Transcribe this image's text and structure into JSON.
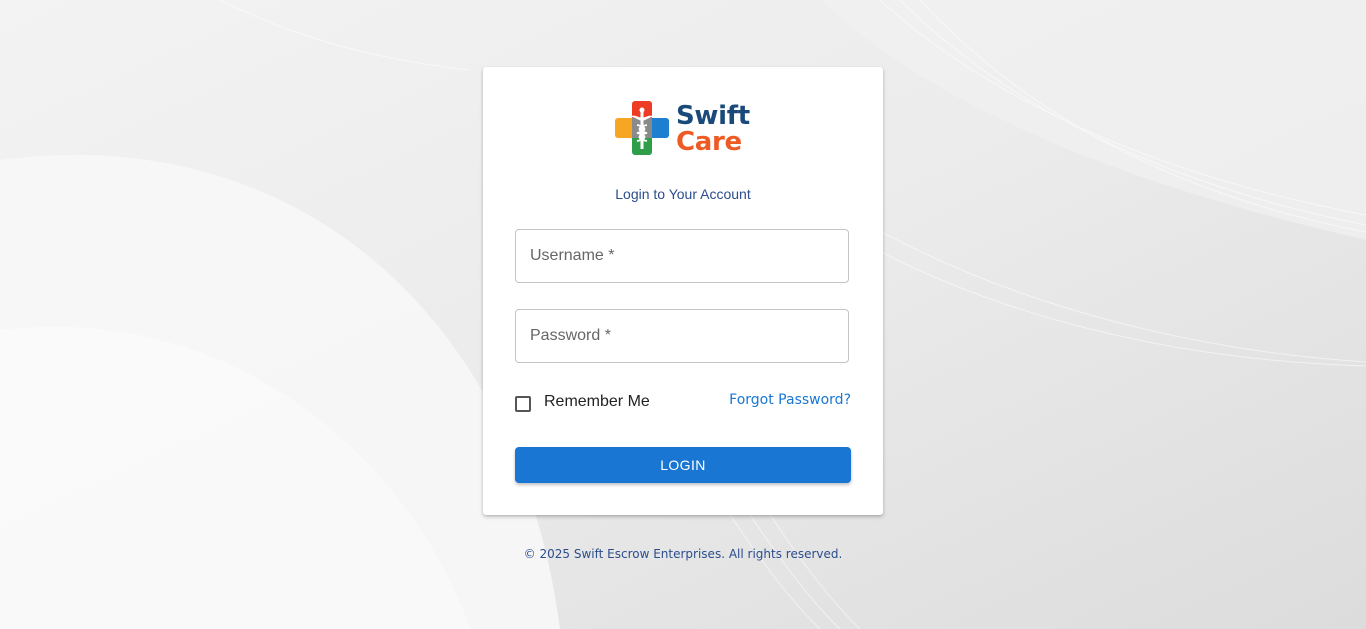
{
  "brand": {
    "name_line1": "Swift",
    "name_line2": "Care",
    "primary_color": "#1a4a7a",
    "accent_color": "#ee5a24",
    "logo_icon": "medical-cross-caduceus-icon"
  },
  "login": {
    "subtitle": "Login to Your Account",
    "username_placeholder": "Username *",
    "password_placeholder": "Password *",
    "remember_label": "Remember Me",
    "remember_checked": false,
    "forgot_label": "Forgot Password?",
    "login_label": "LOGIN",
    "button_color": "#1976d2"
  },
  "footer": {
    "copyright": "© 2025 Swift Escrow Enterprises. All rights reserved."
  }
}
